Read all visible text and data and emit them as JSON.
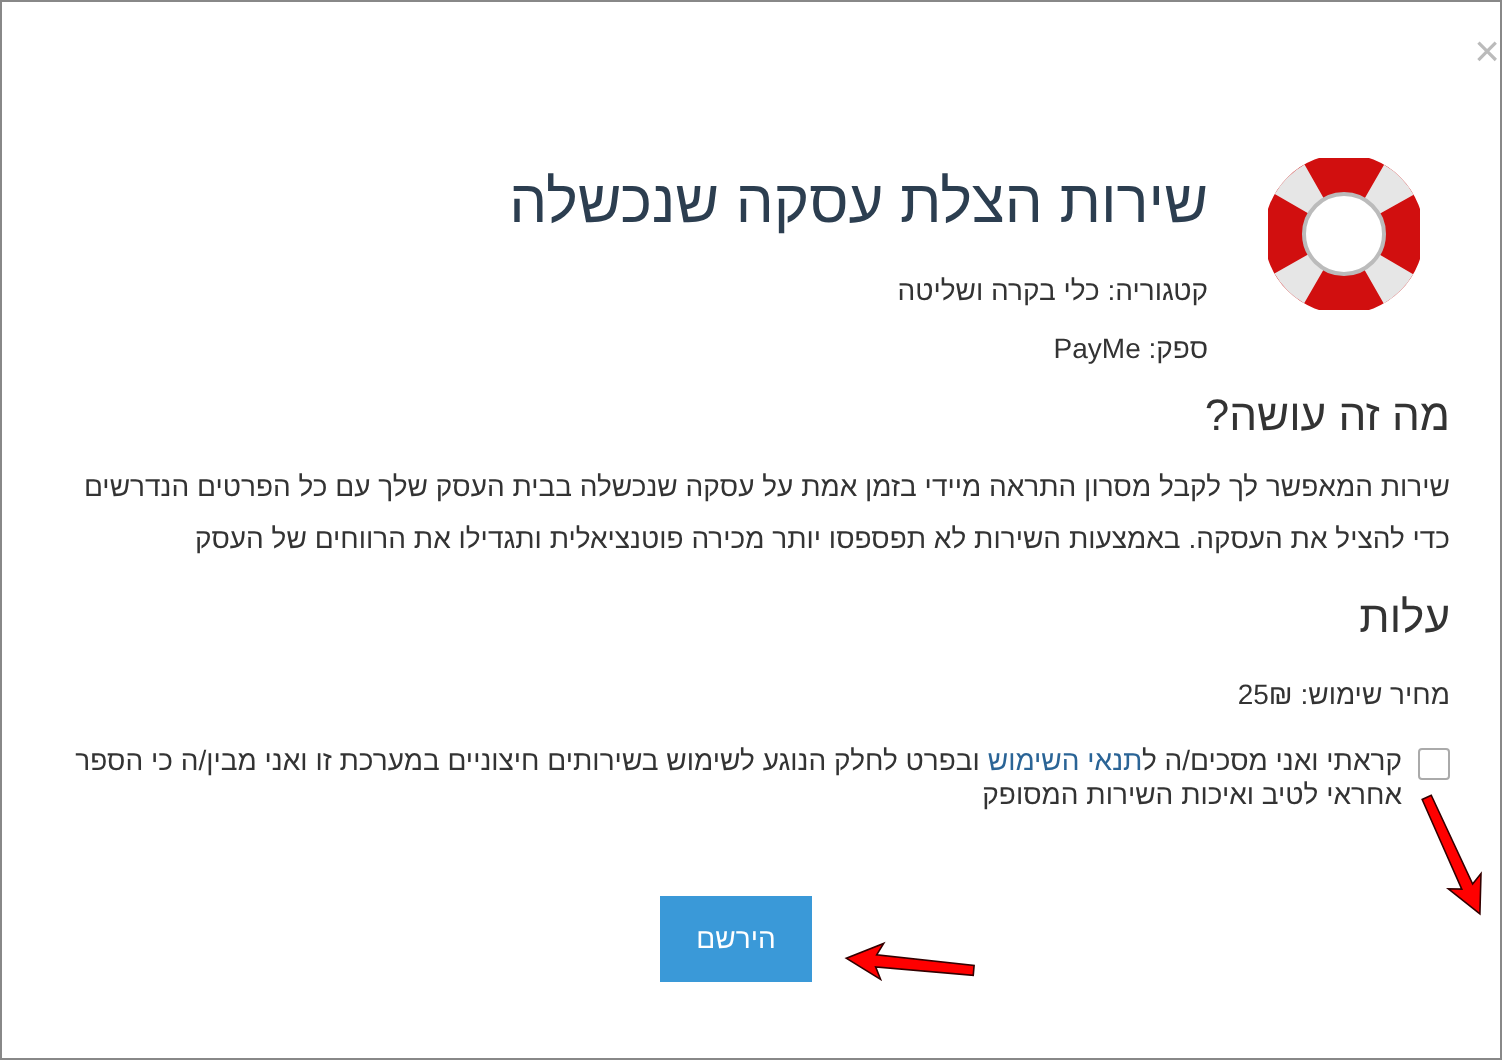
{
  "close": "×",
  "header": {
    "title": "שירות הצלת עסקה שנכשלה",
    "category": "קטגוריה: כלי בקרה ושליטה",
    "provider": "ספק: PayMe"
  },
  "about": {
    "heading": "מה זה עושה?",
    "text": "שירות המאפשר לך לקבל מסרון התראה מיידי בזמן אמת על עסקה שנכשלה בבית העסק שלך עם כל הפרטים הנדרשים כדי להציל את העסקה. באמצעות השירות לא תפספסו יותר מכירה פוטנציאלית ותגדילו את הרווחים של העסק"
  },
  "costs": {
    "heading": "עלות",
    "price": "מחיר שימוש: 25₪"
  },
  "terms": {
    "checked": false,
    "before": "קראתי ואני מסכים/ה ל",
    "link": "תנאי השימוש",
    "after": " ובפרט לחלק הנוגע לשימוש בשירותים חיצוניים במערכת זו ואני מבין/ה כי הספר אחראי לטיב ואיכות השירות המסופק"
  },
  "submit": "הירשם"
}
